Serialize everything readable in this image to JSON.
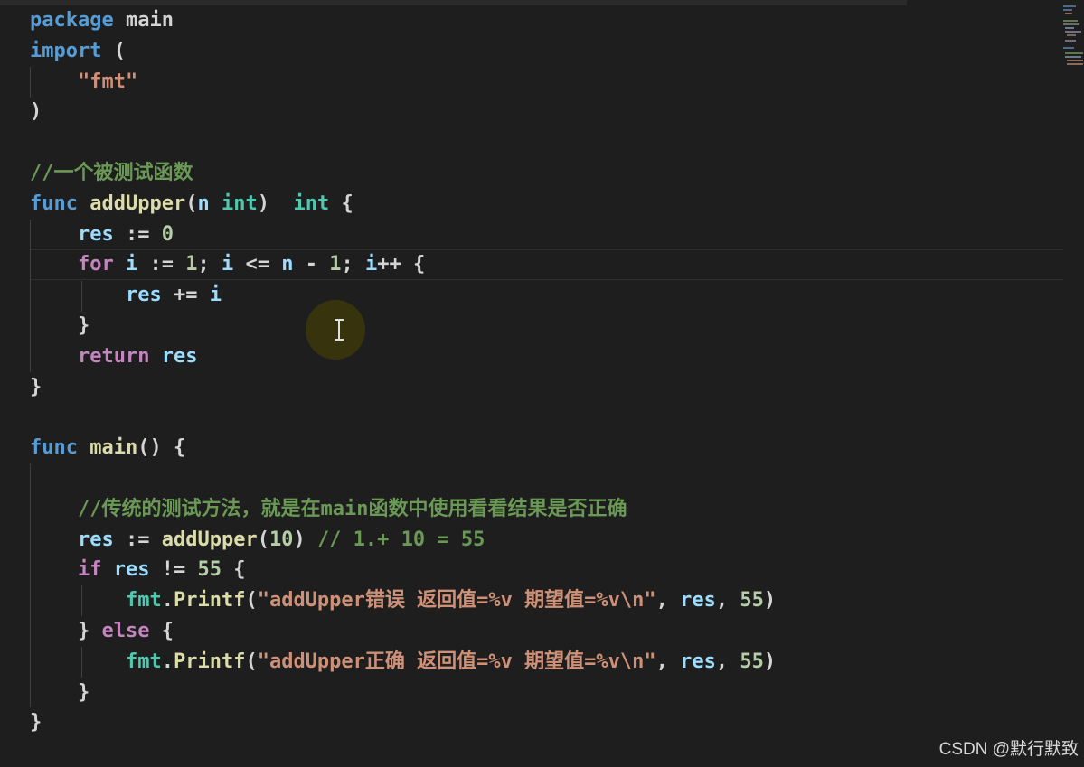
{
  "editor": {
    "language": "go",
    "theme_colors": {
      "background": "#1e1e1e",
      "keyword": "#569cd6",
      "control": "#c586c0",
      "function": "#dcdcaa",
      "variable": "#9cdcfe",
      "type": "#4ec9b0",
      "number": "#b5cea8",
      "string": "#ce9178",
      "comment": "#6a9955"
    },
    "lines": [
      [
        {
          "t": "package",
          "c": "kw"
        },
        {
          "t": " main",
          "c": "pl"
        }
      ],
      [
        {
          "t": "import",
          "c": "kw"
        },
        {
          "t": " (",
          "c": "pl"
        }
      ],
      [
        {
          "t": "    ",
          "c": "pl"
        },
        {
          "t": "\"fmt\"",
          "c": "str"
        }
      ],
      [
        {
          "t": ")",
          "c": "pl"
        }
      ],
      [],
      [
        {
          "t": "//一个被测试函数",
          "c": "cm"
        }
      ],
      [
        {
          "t": "func",
          "c": "kw"
        },
        {
          "t": " ",
          "c": "pl"
        },
        {
          "t": "addUpper",
          "c": "fn"
        },
        {
          "t": "(",
          "c": "pl"
        },
        {
          "t": "n",
          "c": "var"
        },
        {
          "t": " ",
          "c": "pl"
        },
        {
          "t": "int",
          "c": "ty"
        },
        {
          "t": ")  ",
          "c": "pl"
        },
        {
          "t": "int",
          "c": "ty"
        },
        {
          "t": " {",
          "c": "pl"
        }
      ],
      [
        {
          "t": "    ",
          "c": "pl"
        },
        {
          "t": "res",
          "c": "var"
        },
        {
          "t": " := ",
          "c": "pl"
        },
        {
          "t": "0",
          "c": "num"
        }
      ],
      [
        {
          "t": "    ",
          "c": "pl"
        },
        {
          "t": "for",
          "c": "ctl"
        },
        {
          "t": " ",
          "c": "pl"
        },
        {
          "t": "i",
          "c": "var"
        },
        {
          "t": " := ",
          "c": "pl"
        },
        {
          "t": "1",
          "c": "num"
        },
        {
          "t": "; ",
          "c": "pl"
        },
        {
          "t": "i",
          "c": "var"
        },
        {
          "t": " <= ",
          "c": "pl"
        },
        {
          "t": "n",
          "c": "var"
        },
        {
          "t": " - ",
          "c": "pl"
        },
        {
          "t": "1",
          "c": "num"
        },
        {
          "t": "; ",
          "c": "pl"
        },
        {
          "t": "i",
          "c": "var"
        },
        {
          "t": "++ {",
          "c": "pl"
        }
      ],
      [
        {
          "t": "        ",
          "c": "pl"
        },
        {
          "t": "res",
          "c": "var"
        },
        {
          "t": " += ",
          "c": "pl"
        },
        {
          "t": "i",
          "c": "var"
        }
      ],
      [
        {
          "t": "    }",
          "c": "pl"
        }
      ],
      [
        {
          "t": "    ",
          "c": "pl"
        },
        {
          "t": "return",
          "c": "ctl"
        },
        {
          "t": " ",
          "c": "pl"
        },
        {
          "t": "res",
          "c": "var"
        }
      ],
      [
        {
          "t": "}",
          "c": "pl"
        }
      ],
      [],
      [
        {
          "t": "func",
          "c": "kw"
        },
        {
          "t": " ",
          "c": "pl"
        },
        {
          "t": "main",
          "c": "fn"
        },
        {
          "t": "() {",
          "c": "pl"
        }
      ],
      [],
      [
        {
          "t": "    ",
          "c": "pl"
        },
        {
          "t": "//传统的测试方法，就是在main函数中使用看看结果是否正确",
          "c": "cm"
        }
      ],
      [
        {
          "t": "    ",
          "c": "pl"
        },
        {
          "t": "res",
          "c": "var"
        },
        {
          "t": " := ",
          "c": "pl"
        },
        {
          "t": "addUpper",
          "c": "fn"
        },
        {
          "t": "(",
          "c": "pl"
        },
        {
          "t": "10",
          "c": "num"
        },
        {
          "t": ") ",
          "c": "pl"
        },
        {
          "t": "// 1.+ 10 = 55",
          "c": "cm"
        }
      ],
      [
        {
          "t": "    ",
          "c": "pl"
        },
        {
          "t": "if",
          "c": "ctl"
        },
        {
          "t": " ",
          "c": "pl"
        },
        {
          "t": "res",
          "c": "var"
        },
        {
          "t": " != ",
          "c": "pl"
        },
        {
          "t": "55",
          "c": "num"
        },
        {
          "t": " {",
          "c": "pl"
        }
      ],
      [
        {
          "t": "        ",
          "c": "pl"
        },
        {
          "t": "fmt",
          "c": "ty"
        },
        {
          "t": ".",
          "c": "pl"
        },
        {
          "t": "Printf",
          "c": "fn"
        },
        {
          "t": "(",
          "c": "pl"
        },
        {
          "t": "\"addUpper错误 返回值=%v 期望值=%v\\n\"",
          "c": "str"
        },
        {
          "t": ", ",
          "c": "pl"
        },
        {
          "t": "res",
          "c": "var"
        },
        {
          "t": ", ",
          "c": "pl"
        },
        {
          "t": "55",
          "c": "num"
        },
        {
          "t": ")",
          "c": "pl"
        }
      ],
      [
        {
          "t": "    } ",
          "c": "pl"
        },
        {
          "t": "else",
          "c": "ctl"
        },
        {
          "t": " {",
          "c": "pl"
        }
      ],
      [
        {
          "t": "        ",
          "c": "pl"
        },
        {
          "t": "fmt",
          "c": "ty"
        },
        {
          "t": ".",
          "c": "pl"
        },
        {
          "t": "Printf",
          "c": "fn"
        },
        {
          "t": "(",
          "c": "pl"
        },
        {
          "t": "\"addUpper正确 返回值=%v 期望值=%v\\n\"",
          "c": "str"
        },
        {
          "t": ", ",
          "c": "pl"
        },
        {
          "t": "res",
          "c": "var"
        },
        {
          "t": ", ",
          "c": "pl"
        },
        {
          "t": "55",
          "c": "num"
        },
        {
          "t": ")",
          "c": "pl"
        }
      ],
      [
        {
          "t": "    }",
          "c": "pl"
        }
      ],
      [
        {
          "t": "}",
          "c": "pl"
        }
      ]
    ]
  },
  "watermark": {
    "text": "CSDN @默行默致"
  }
}
